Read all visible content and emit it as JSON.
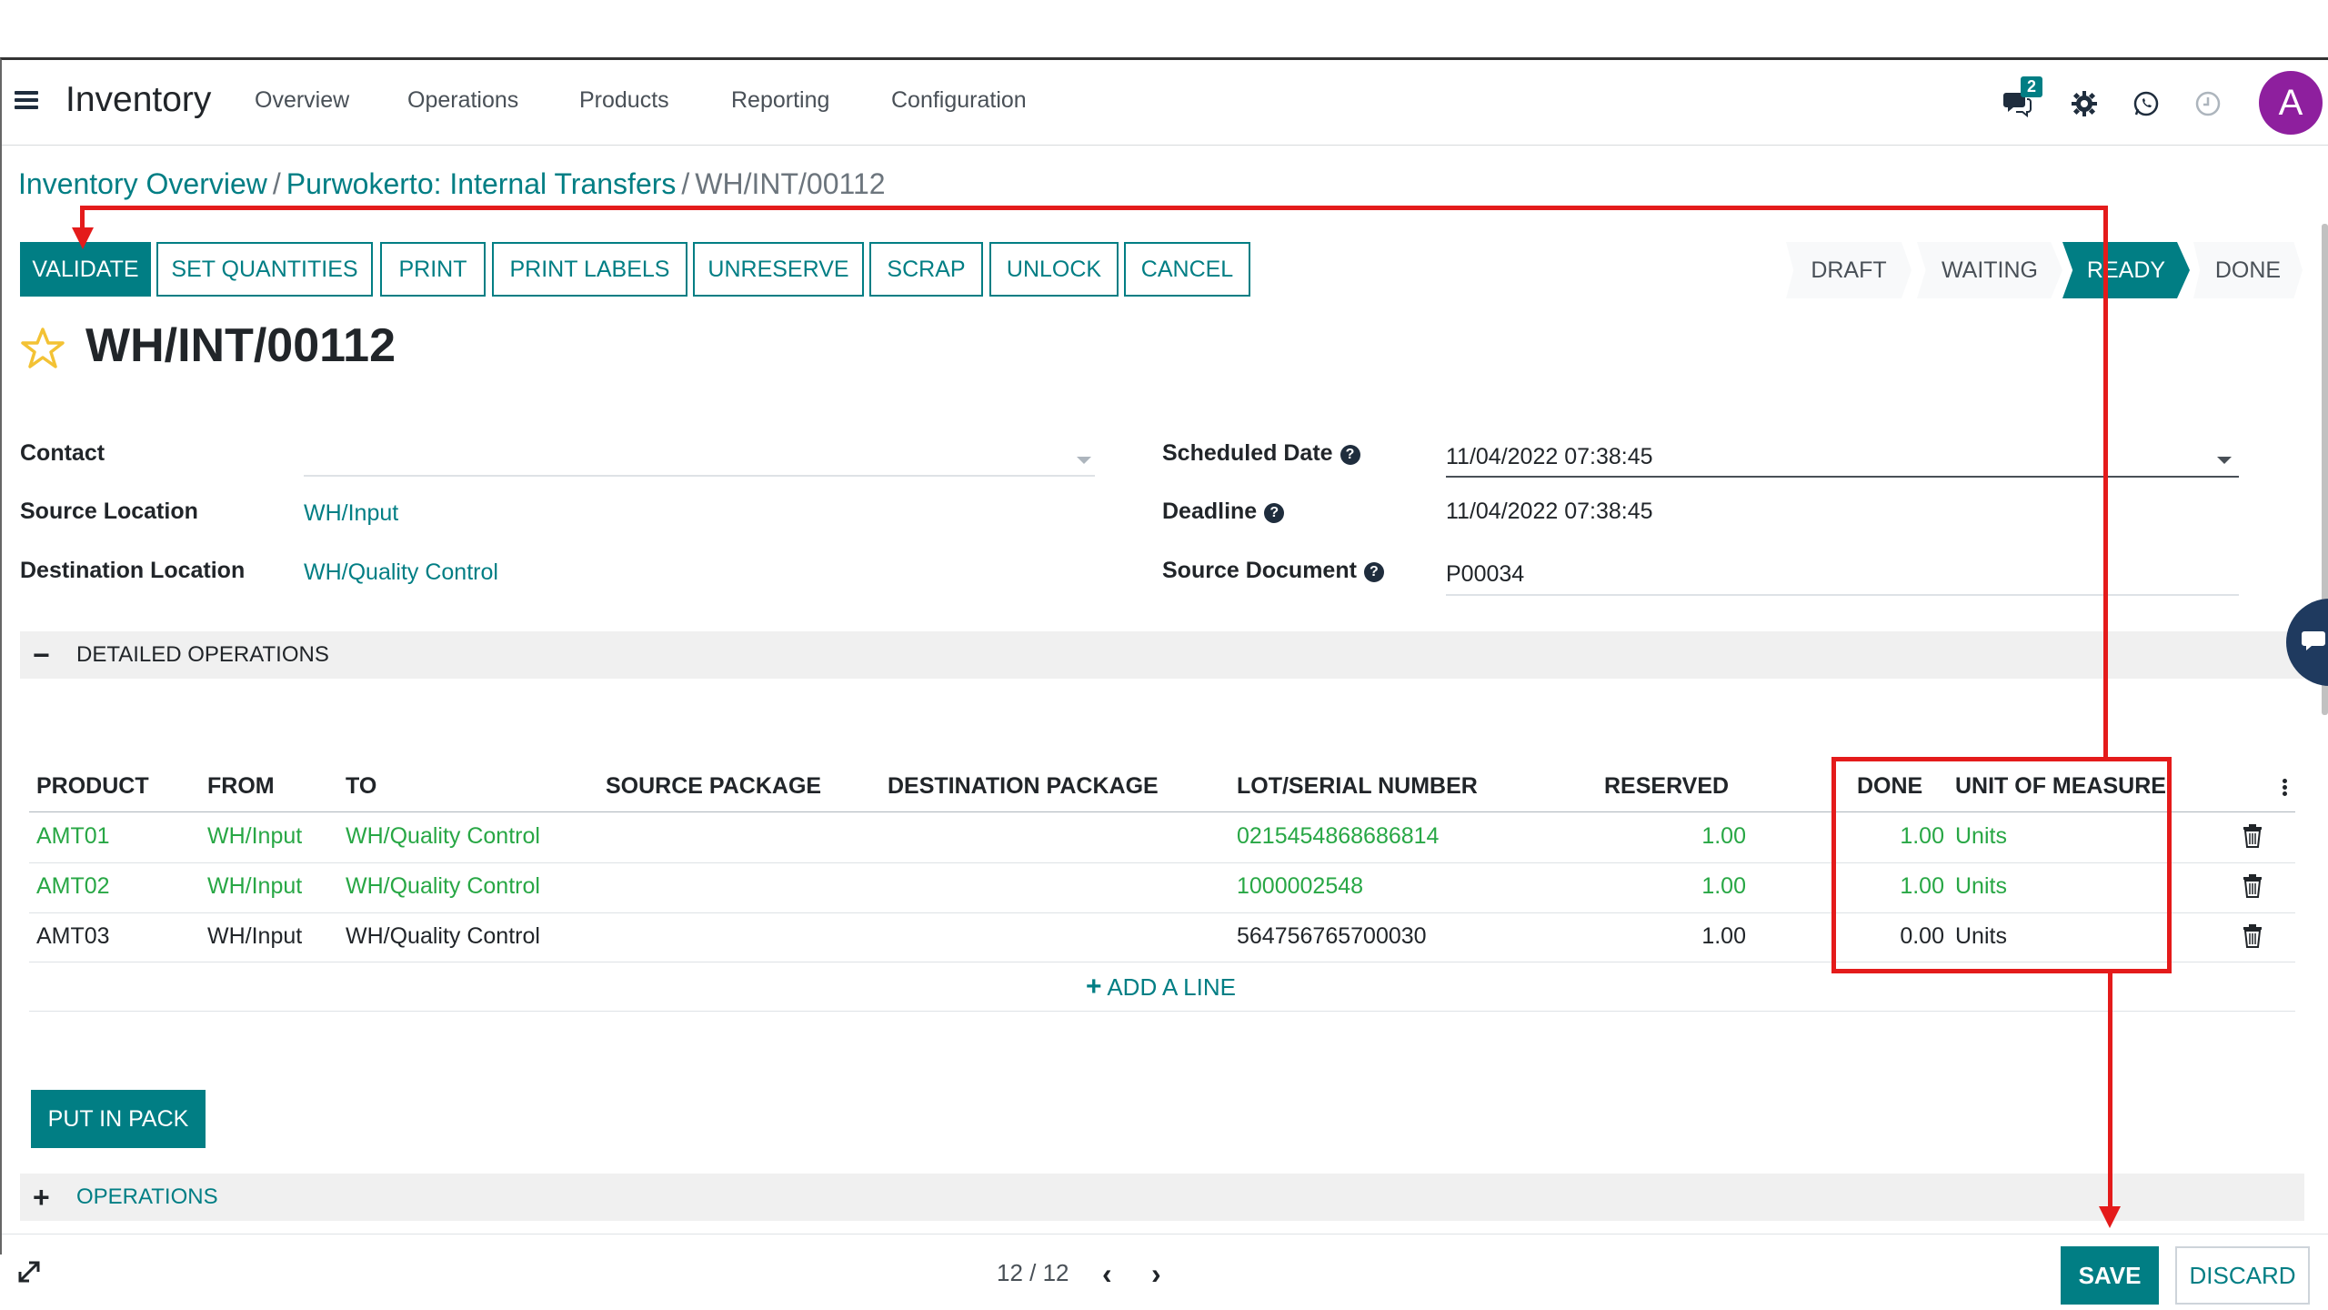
{
  "navbar": {
    "app_title": "Inventory",
    "menu": [
      "Overview",
      "Operations",
      "Products",
      "Reporting",
      "Configuration"
    ],
    "messages_badge": "2",
    "avatar_letter": "A",
    "icons": [
      "menu-icon",
      "chat-icon",
      "settings-icon",
      "whatsapp-icon",
      "clock-icon"
    ]
  },
  "breadcrumb": {
    "items": [
      "Inventory Overview",
      "Purwokerto: Internal Transfers"
    ],
    "current": "WH/INT/00112"
  },
  "actions": [
    "VALIDATE",
    "SET QUANTITIES",
    "PRINT",
    "PRINT LABELS",
    "UNRESERVE",
    "SCRAP",
    "UNLOCK",
    "CANCEL"
  ],
  "status": {
    "steps": [
      "DRAFT",
      "WAITING",
      "READY",
      "DONE"
    ],
    "active": "READY"
  },
  "record": {
    "title": "WH/INT/00112"
  },
  "form": {
    "contact_label": "Contact",
    "contact_value": "",
    "source_location_label": "Source Location",
    "source_location_value": "WH/Input",
    "destination_location_label": "Destination Location",
    "destination_location_value": "WH/Quality Control",
    "scheduled_date_label": "Scheduled Date",
    "scheduled_date_value": "11/04/2022 07:38:45",
    "deadline_label": "Deadline",
    "deadline_value": "11/04/2022 07:38:45",
    "source_document_label": "Source Document",
    "source_document_value": "P00034",
    "help_glyph": "?"
  },
  "detailed_operations": {
    "section_label": "DETAILED OPERATIONS",
    "columns": [
      "PRODUCT",
      "FROM",
      "TO",
      "SOURCE PACKAGE",
      "DESTINATION PACKAGE",
      "LOT/SERIAL NUMBER",
      "RESERVED",
      "DONE",
      "UNIT OF MEASURE"
    ],
    "rows": [
      {
        "product": "AMT01",
        "from": "WH/Input",
        "to": "WH/Quality Control",
        "lot": "0215454868686814",
        "reserved": "1.00",
        "done": "1.00",
        "uom": "Units"
      },
      {
        "product": "AMT02",
        "from": "WH/Input",
        "to": "WH/Quality Control",
        "lot": "1000002548",
        "reserved": "1.00",
        "done": "1.00",
        "uom": "Units"
      },
      {
        "product": "AMT03",
        "from": "WH/Input",
        "to": "WH/Quality Control",
        "lot": "564756765700030",
        "reserved": "1.00",
        "done": "0.00",
        "uom": "Units"
      }
    ],
    "add_line": "ADD A LINE"
  },
  "put_in_pack": "PUT IN PACK",
  "operations_section": "OPERATIONS",
  "footer": {
    "pager": "12 / 12",
    "save": "SAVE",
    "discard": "DISCARD"
  },
  "colors": {
    "accent": "#017e84",
    "annotation": "#e41b1b",
    "link_green": "#28a745",
    "avatar": "#8e1f9e"
  }
}
